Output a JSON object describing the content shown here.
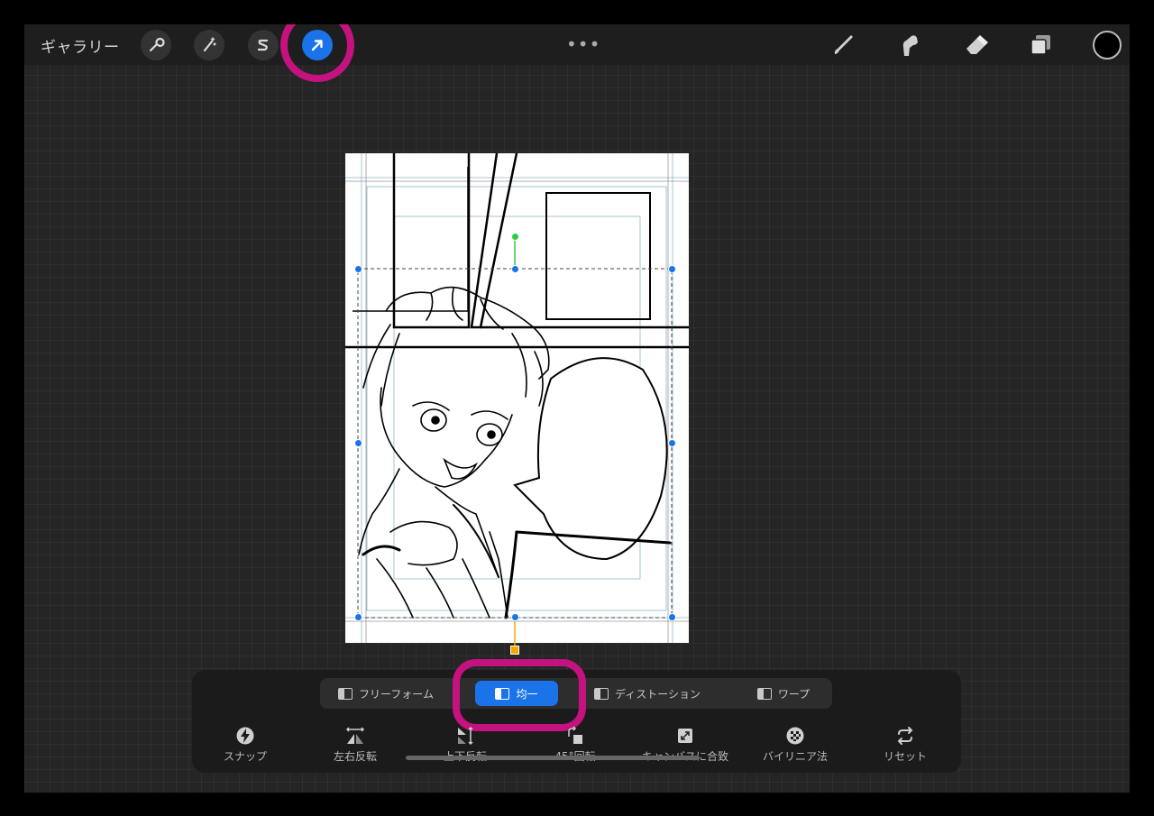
{
  "topbar": {
    "gallery_label": "ギャラリー",
    "more_label": "•••",
    "tools_left": [
      "wrench-icon",
      "magic-wand-icon",
      "selection-icon",
      "transform-arrow-icon"
    ],
    "tools_right": [
      "brush-icon",
      "smudge-icon",
      "eraser-icon",
      "layers-icon"
    ],
    "current_color": "#000000"
  },
  "transform": {
    "modes": [
      {
        "label": "フリーフォーム",
        "icon": "freeform-icon"
      },
      {
        "label": "均一",
        "icon": "uniform-icon",
        "active": true
      },
      {
        "label": "ディストーション",
        "icon": "distort-icon"
      },
      {
        "label": "ワープ",
        "icon": "warp-icon"
      }
    ],
    "options": [
      {
        "label": "スナップ",
        "icon": "snap-icon"
      },
      {
        "label": "左右反転",
        "icon": "flip-horizontal-icon"
      },
      {
        "label": "上下反転",
        "icon": "flip-vertical-icon"
      },
      {
        "label": "45°回転",
        "icon": "rotate-45-icon"
      },
      {
        "label": "キャンバスに合致",
        "icon": "fit-canvas-icon"
      },
      {
        "label": "バイリニア法",
        "icon": "bilinear-icon"
      },
      {
        "label": "リセット",
        "icon": "reset-icon"
      }
    ]
  },
  "colors": {
    "accent": "#1a73e8",
    "highlight_ring": "#c4127e"
  }
}
